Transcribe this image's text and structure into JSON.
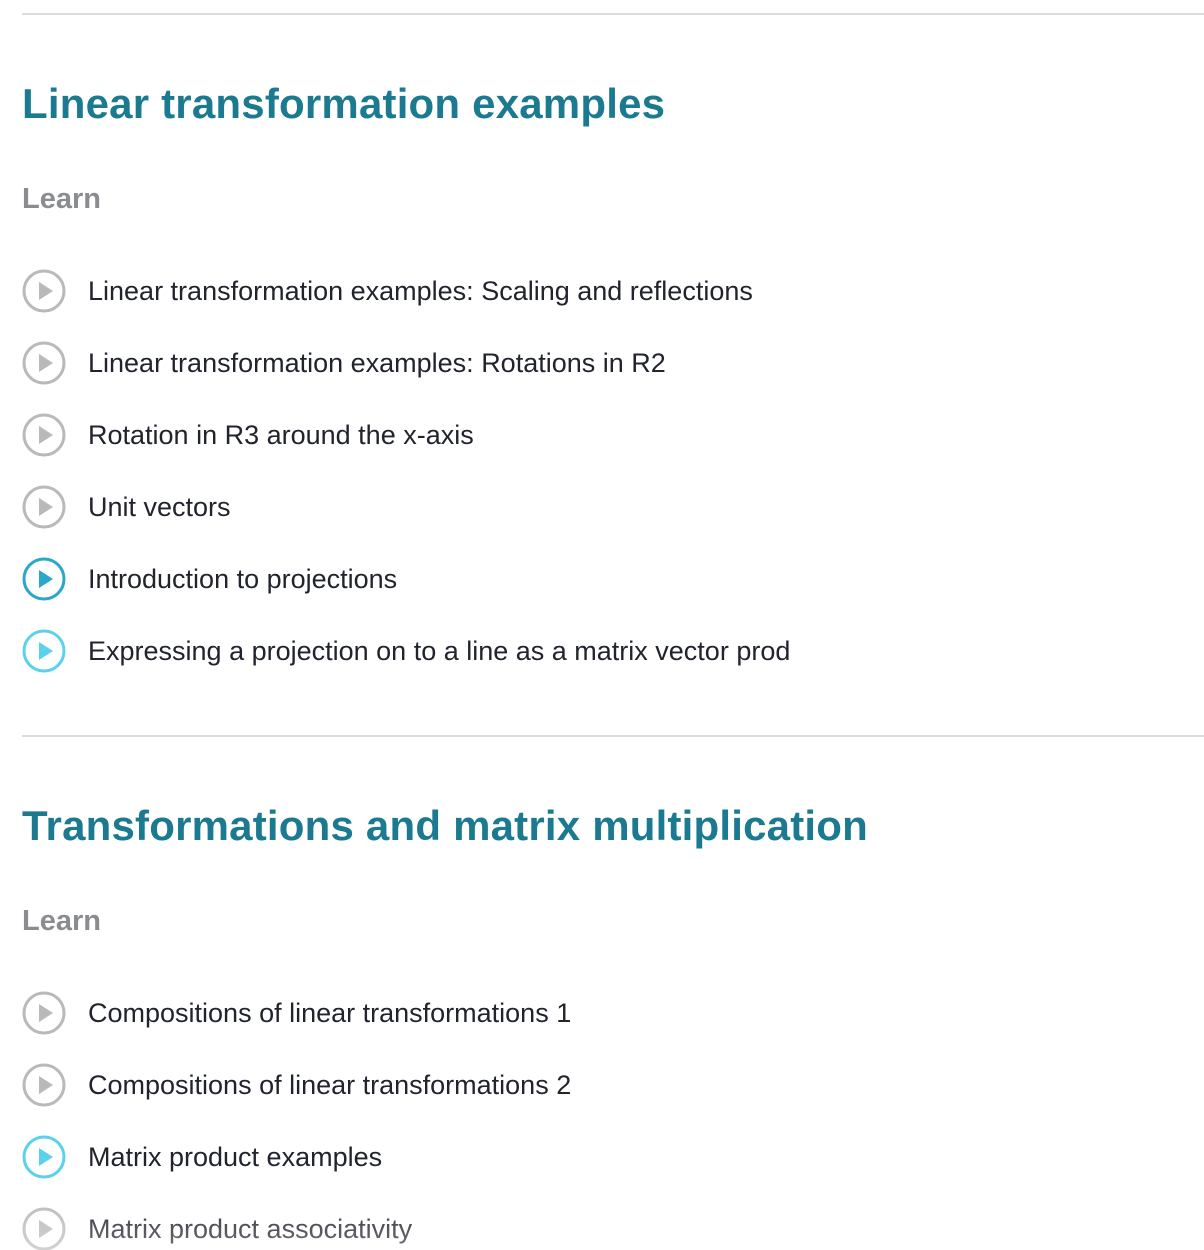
{
  "sections": [
    {
      "title": "Linear transformation examples",
      "label": "Learn",
      "lessons": [
        {
          "title": "Linear transformation examples: Scaling and reflections",
          "state": "unwatched",
          "icon": "play-icon"
        },
        {
          "title": "Linear transformation examples: Rotations in R2",
          "state": "unwatched",
          "icon": "play-icon"
        },
        {
          "title": "Rotation in R3 around the x-axis",
          "state": "unwatched",
          "icon": "play-icon"
        },
        {
          "title": "Unit vectors",
          "state": "unwatched",
          "icon": "play-icon"
        },
        {
          "title": "Introduction to projections",
          "state": "started",
          "icon": "play-icon"
        },
        {
          "title": "Expressing a projection on to a line as a matrix vector prod",
          "state": "watched",
          "icon": "play-icon"
        }
      ]
    },
    {
      "title": "Transformations and matrix multiplication",
      "label": "Learn",
      "lessons": [
        {
          "title": "Compositions of linear transformations 1",
          "state": "unwatched",
          "icon": "play-icon"
        },
        {
          "title": "Compositions of linear transformations 2",
          "state": "unwatched",
          "icon": "play-icon"
        },
        {
          "title": "Matrix product examples",
          "state": "watched",
          "icon": "play-icon"
        },
        {
          "title": "Matrix product associativity",
          "state": "unwatched",
          "icon": "play-icon"
        }
      ]
    }
  ],
  "colors": {
    "title": "#1b7a8f",
    "label": "#8a8c90",
    "text": "#21242c",
    "divider": "#dcdcdc",
    "icon_unwatched": "#b9b9bb",
    "icon_started": "#29a8c9",
    "icon_watched": "#5ad2eb"
  }
}
